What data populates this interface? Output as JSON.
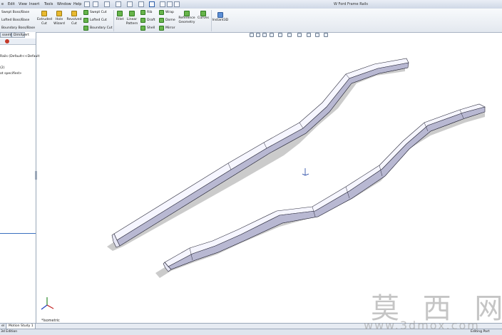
{
  "menu": {
    "items": [
      "e",
      "Edit",
      "View",
      "Insert",
      "Tools",
      "Window",
      "Help"
    ]
  },
  "document": {
    "title": "W Ford Frame Rails"
  },
  "ribbon": {
    "boss_group": [
      "Swept Boss/Base",
      "Lofted Boss/Base",
      "Boundary Boss/Base"
    ],
    "extruded_cut": [
      "Extruded",
      "Cut"
    ],
    "hole_wizard": [
      "Hole",
      "Wizard"
    ],
    "revolved_cut": [
      "Revolved",
      "Cut"
    ],
    "cut_group": [
      "Swept Cut",
      "Lofted Cut",
      "Boundary Cut"
    ],
    "fillet": "Fillet",
    "linear_pattern": [
      "Linear",
      "Pattern"
    ],
    "features_col1": [
      "Rib",
      "Draft",
      "Shell"
    ],
    "features_col2": [
      "Wrap",
      "Dome",
      "Mirror"
    ],
    "reference_geometry": [
      "Reference",
      "Geometry"
    ],
    "curves": "Curves",
    "instant3d": "Instant3D"
  },
  "feature_tree": {
    "tabs": [
      "ssembly",
      "Sketch",
      "Evaluate",
      "DimXpert"
    ],
    "root": "Rails (Default<<Default",
    "lines": [
      "(2)",
      "ot specified>"
    ]
  },
  "viewport": {
    "view_label": "*Isometric"
  },
  "bottom_tabs": [
    "el",
    "Motion Study 1"
  ],
  "status": {
    "left": "3d Edition",
    "right": "Editing Part"
  },
  "watermark": {
    "text": "莫 西 网",
    "url": "www.3dmox.com"
  },
  "colors": {
    "part_face": "#f6f6ff",
    "part_shade": "#b8b8d2",
    "part_edge": "#2a2a3a",
    "shadow": "#a9a9a9"
  }
}
